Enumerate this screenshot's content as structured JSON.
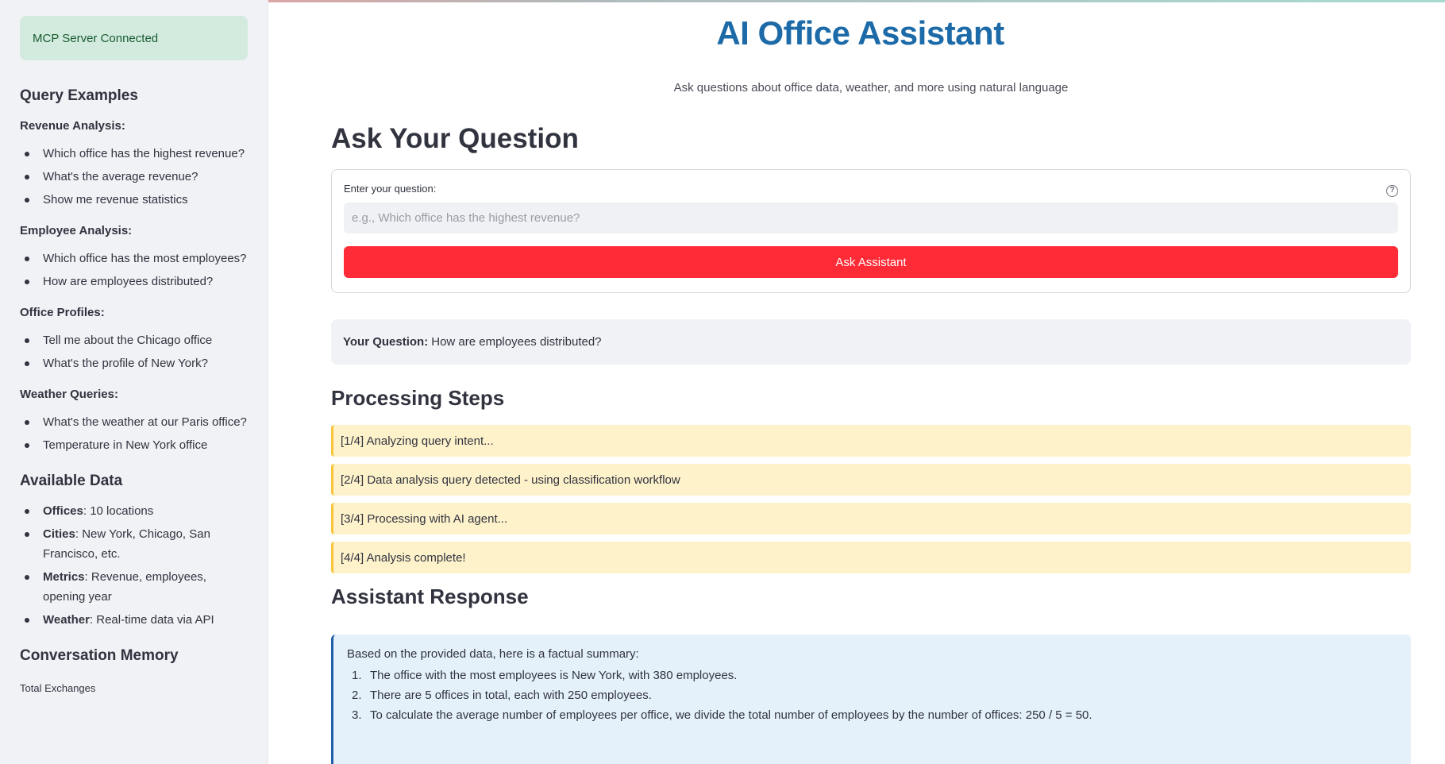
{
  "sidebar": {
    "status": "MCP Server Connected",
    "query_examples_title": "Query Examples",
    "sections": [
      {
        "title": "Revenue Analysis:",
        "items": [
          "Which office has the highest revenue?",
          "What's the average revenue?",
          "Show me revenue statistics"
        ]
      },
      {
        "title": "Employee Analysis:",
        "items": [
          "Which office has the most employees?",
          "How are employees distributed?"
        ]
      },
      {
        "title": "Office Profiles:",
        "items": [
          "Tell me about the Chicago office",
          "What's the profile of New York?"
        ]
      },
      {
        "title": "Weather Queries:",
        "items": [
          "What's the weather at our Paris office?",
          "Temperature in New York office"
        ]
      }
    ],
    "available_data_title": "Available Data",
    "available_data": [
      {
        "key": "Offices",
        "value": ": 10 locations"
      },
      {
        "key": "Cities",
        "value": ": New York, Chicago, San Francisco, etc."
      },
      {
        "key": "Metrics",
        "value": ": Revenue, employees, opening year"
      },
      {
        "key": "Weather",
        "value": ": Real-time data via API"
      }
    ],
    "memory_title": "Conversation Memory",
    "memory_label": "Total Exchanges"
  },
  "main": {
    "title": "AI Office Assistant",
    "subtitle": "Ask questions about office data, weather, and more using natural language",
    "ask_title": "Ask Your Question",
    "input_label": "Enter your question:",
    "input_placeholder": "e.g., Which office has the highest revenue?",
    "input_value": "",
    "help_icon_glyph": "?",
    "ask_button": "Ask Assistant",
    "your_question_label": "Your Question:",
    "your_question_value": "How are employees distributed?",
    "steps_title": "Processing Steps",
    "steps": [
      "[1/4] Analyzing query intent...",
      "[2/4] Data analysis query detected - using classification workflow",
      "[3/4] Processing with AI agent...",
      "[4/4] Analysis complete!"
    ],
    "response_title": "Assistant Response",
    "response_intro": "Based on the provided data, here is a factual summary:",
    "response_items": [
      {
        "num": "1.",
        "text": "The office with the most employees is New York, with 380 employees."
      },
      {
        "num": "2.",
        "text": "There are 5 offices in total, each with 250 employees."
      },
      {
        "num": "3.",
        "text": "To calculate the average number of employees per office, we divide the total number of employees by the number of offices: 250 / 5 = 50."
      }
    ]
  },
  "colors": {
    "accent_title": "#1c6aa8",
    "button": "#ff2b36",
    "success_bg": "#d3eadf",
    "step_bg": "#fef2cb",
    "step_border": "#f7c43a",
    "response_bg": "#e4f1fb",
    "response_border": "#1f5fa8"
  }
}
